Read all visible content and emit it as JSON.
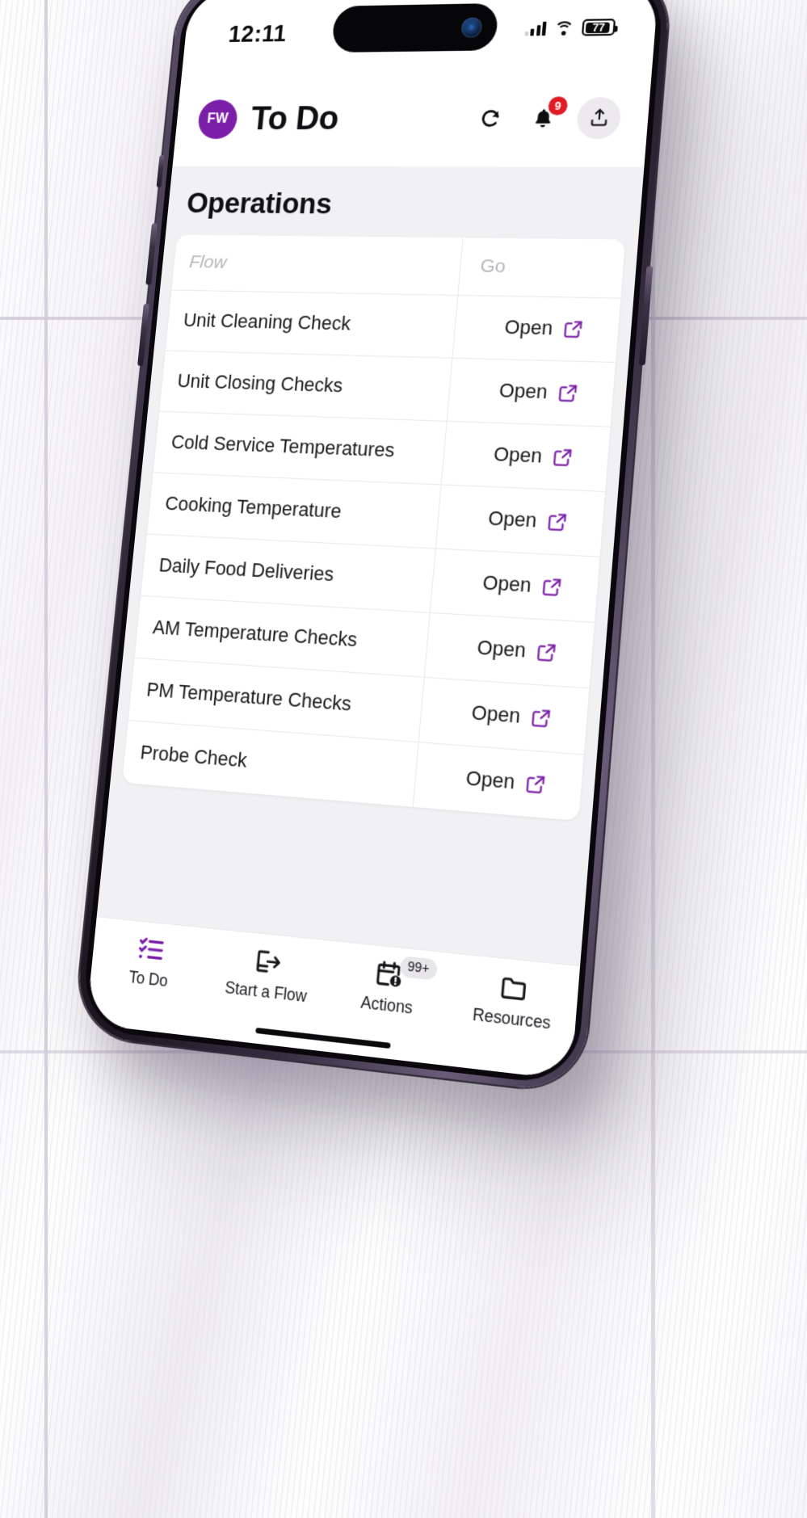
{
  "status_bar": {
    "time": "12:11",
    "battery_percent": "77",
    "signal_icon": "cellular-signal-icon",
    "wifi_icon": "wifi-icon",
    "battery_icon": "battery-icon"
  },
  "header": {
    "avatar_initials": "FW",
    "title": "To Do",
    "refresh_icon": "refresh-icon",
    "notifications_icon": "bell-icon",
    "notifications_badge": "9",
    "upload_icon": "upload-icon"
  },
  "main": {
    "section_title": "Operations",
    "table": {
      "columns": [
        "Flow",
        "Go"
      ],
      "rows": [
        {
          "flow": "Unit Cleaning Check",
          "action": "Open",
          "action_icon": "external-link-icon"
        },
        {
          "flow": "Unit Closing Checks",
          "action": "Open",
          "action_icon": "external-link-icon"
        },
        {
          "flow": "Cold Service Temperatures",
          "action": "Open",
          "action_icon": "external-link-icon"
        },
        {
          "flow": "Cooking Temperature",
          "action": "Open",
          "action_icon": "external-link-icon"
        },
        {
          "flow": "Daily Food Deliveries",
          "action": "Open",
          "action_icon": "external-link-icon"
        },
        {
          "flow": "AM Temperature Checks",
          "action": "Open",
          "action_icon": "external-link-icon"
        },
        {
          "flow": "PM Temperature Checks",
          "action": "Open",
          "action_icon": "external-link-icon"
        },
        {
          "flow": "Probe Check",
          "action": "Open",
          "action_icon": "external-link-icon"
        }
      ]
    }
  },
  "tabbar": {
    "items": [
      {
        "label": "To Do",
        "icon": "checklist-icon",
        "active": true,
        "badge": ""
      },
      {
        "label": "Start a Flow",
        "icon": "flow-arrow-icon",
        "active": false,
        "badge": ""
      },
      {
        "label": "Actions",
        "icon": "calendar-alert-icon",
        "active": false,
        "badge": "99+"
      },
      {
        "label": "Resources",
        "icon": "folder-icon",
        "active": false,
        "badge": ""
      }
    ]
  },
  "colors": {
    "brand_purple": "#7b1fa8",
    "badge_red": "#e01b24",
    "content_bg": "#f1f0f2"
  }
}
